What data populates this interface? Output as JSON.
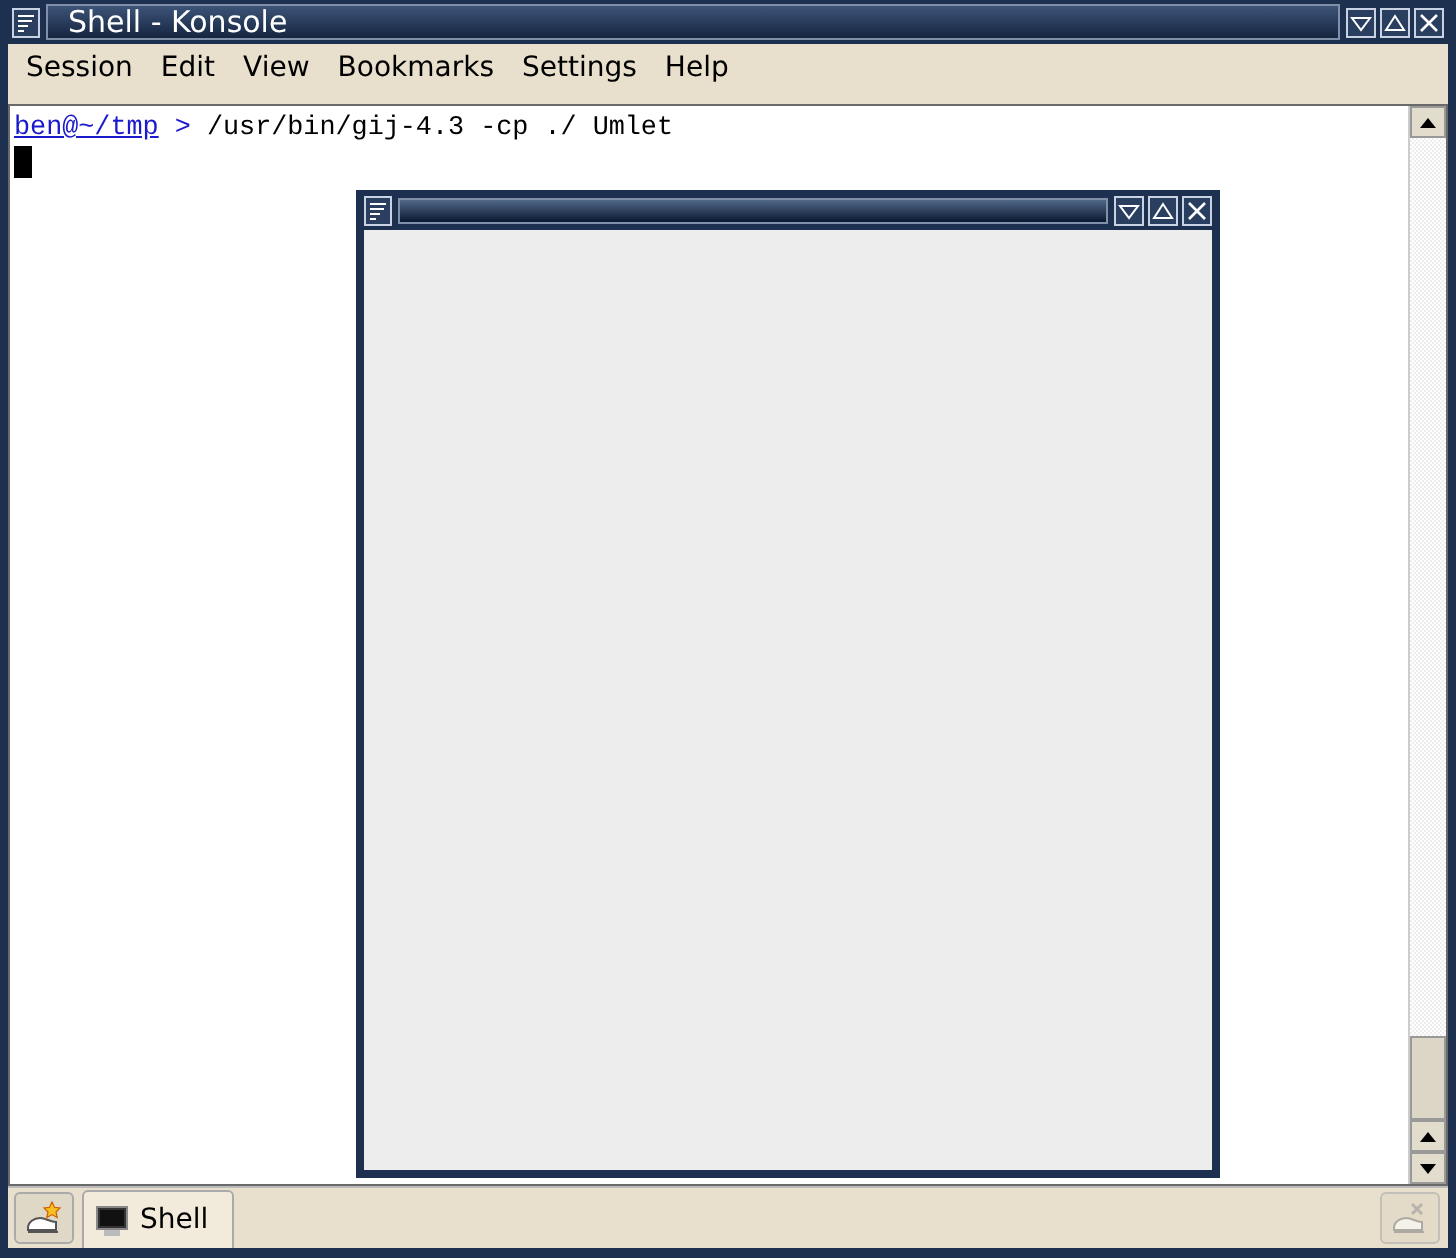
{
  "window": {
    "title": "Shell - Konsole"
  },
  "menu": [
    "Session",
    "Edit",
    "View",
    "Bookmarks",
    "Settings",
    "Help"
  ],
  "terminal": {
    "prompt": "ben@~/tmp",
    "prompt_sign": ">",
    "command": "/usr/bin/gij-4.3 -cp ./ Umlet"
  },
  "child_window": {
    "kind": "empty"
  },
  "tabs": [
    {
      "label": "Shell",
      "selected": true
    }
  ]
}
